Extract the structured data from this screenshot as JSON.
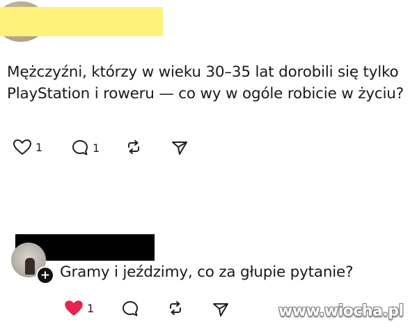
{
  "post": {
    "text": "Mężczyźni, którzy w wieku 30–35 lat dorobili się tylko PlayStation i roweru — co wy w ogóle robicie w życiu?",
    "likes": "1",
    "replies": "1"
  },
  "reply": {
    "text": "Gramy i jeździmy, co za głupie pytanie?",
    "likes": "1",
    "follow_symbol": "+",
    "liked_color": "#e5254d"
  },
  "watermark": "www.wiocha.pl"
}
